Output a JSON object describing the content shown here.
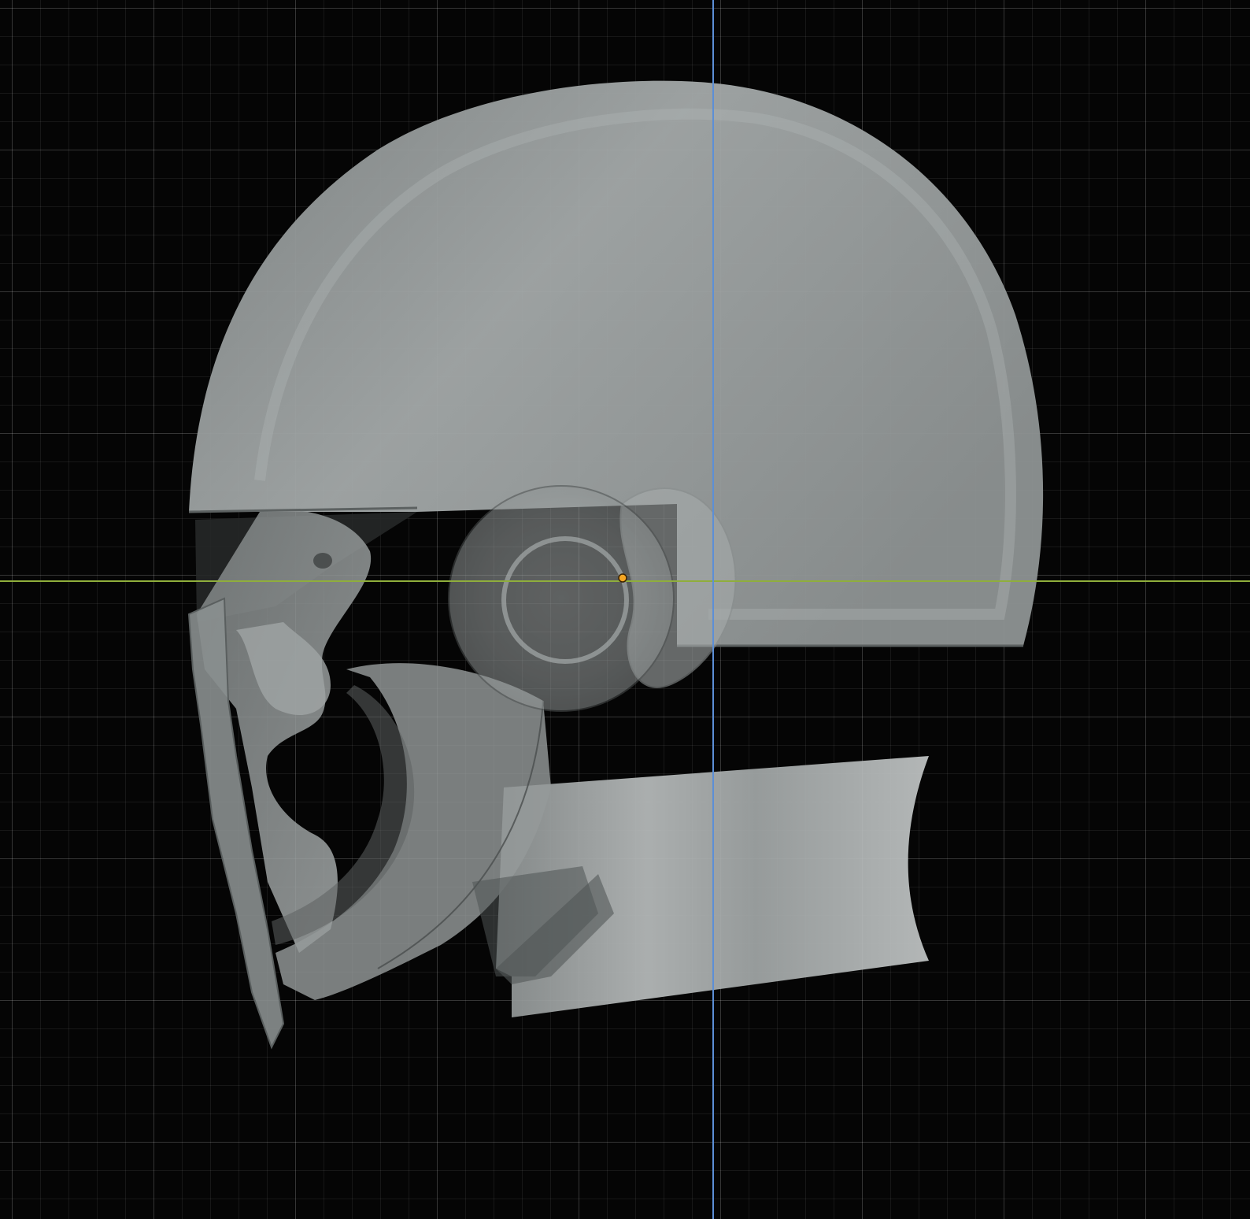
{
  "viewport": {
    "background": "#050505",
    "grid_major": "#2a2a2a",
    "grid_minor": "#161616"
  },
  "axes": {
    "x_axis_color": "#8fae3c",
    "z_axis_color": "#5c8fd6"
  },
  "model": {
    "object": "helmet-with-head",
    "base_color": "#9ea3a3",
    "shadow_color": "#6d7272",
    "highlight_color": "#c4c8c8"
  },
  "origin": {
    "color": "#f5a623"
  },
  "ear_cup": {
    "outline_color": "#4a4e4e"
  }
}
